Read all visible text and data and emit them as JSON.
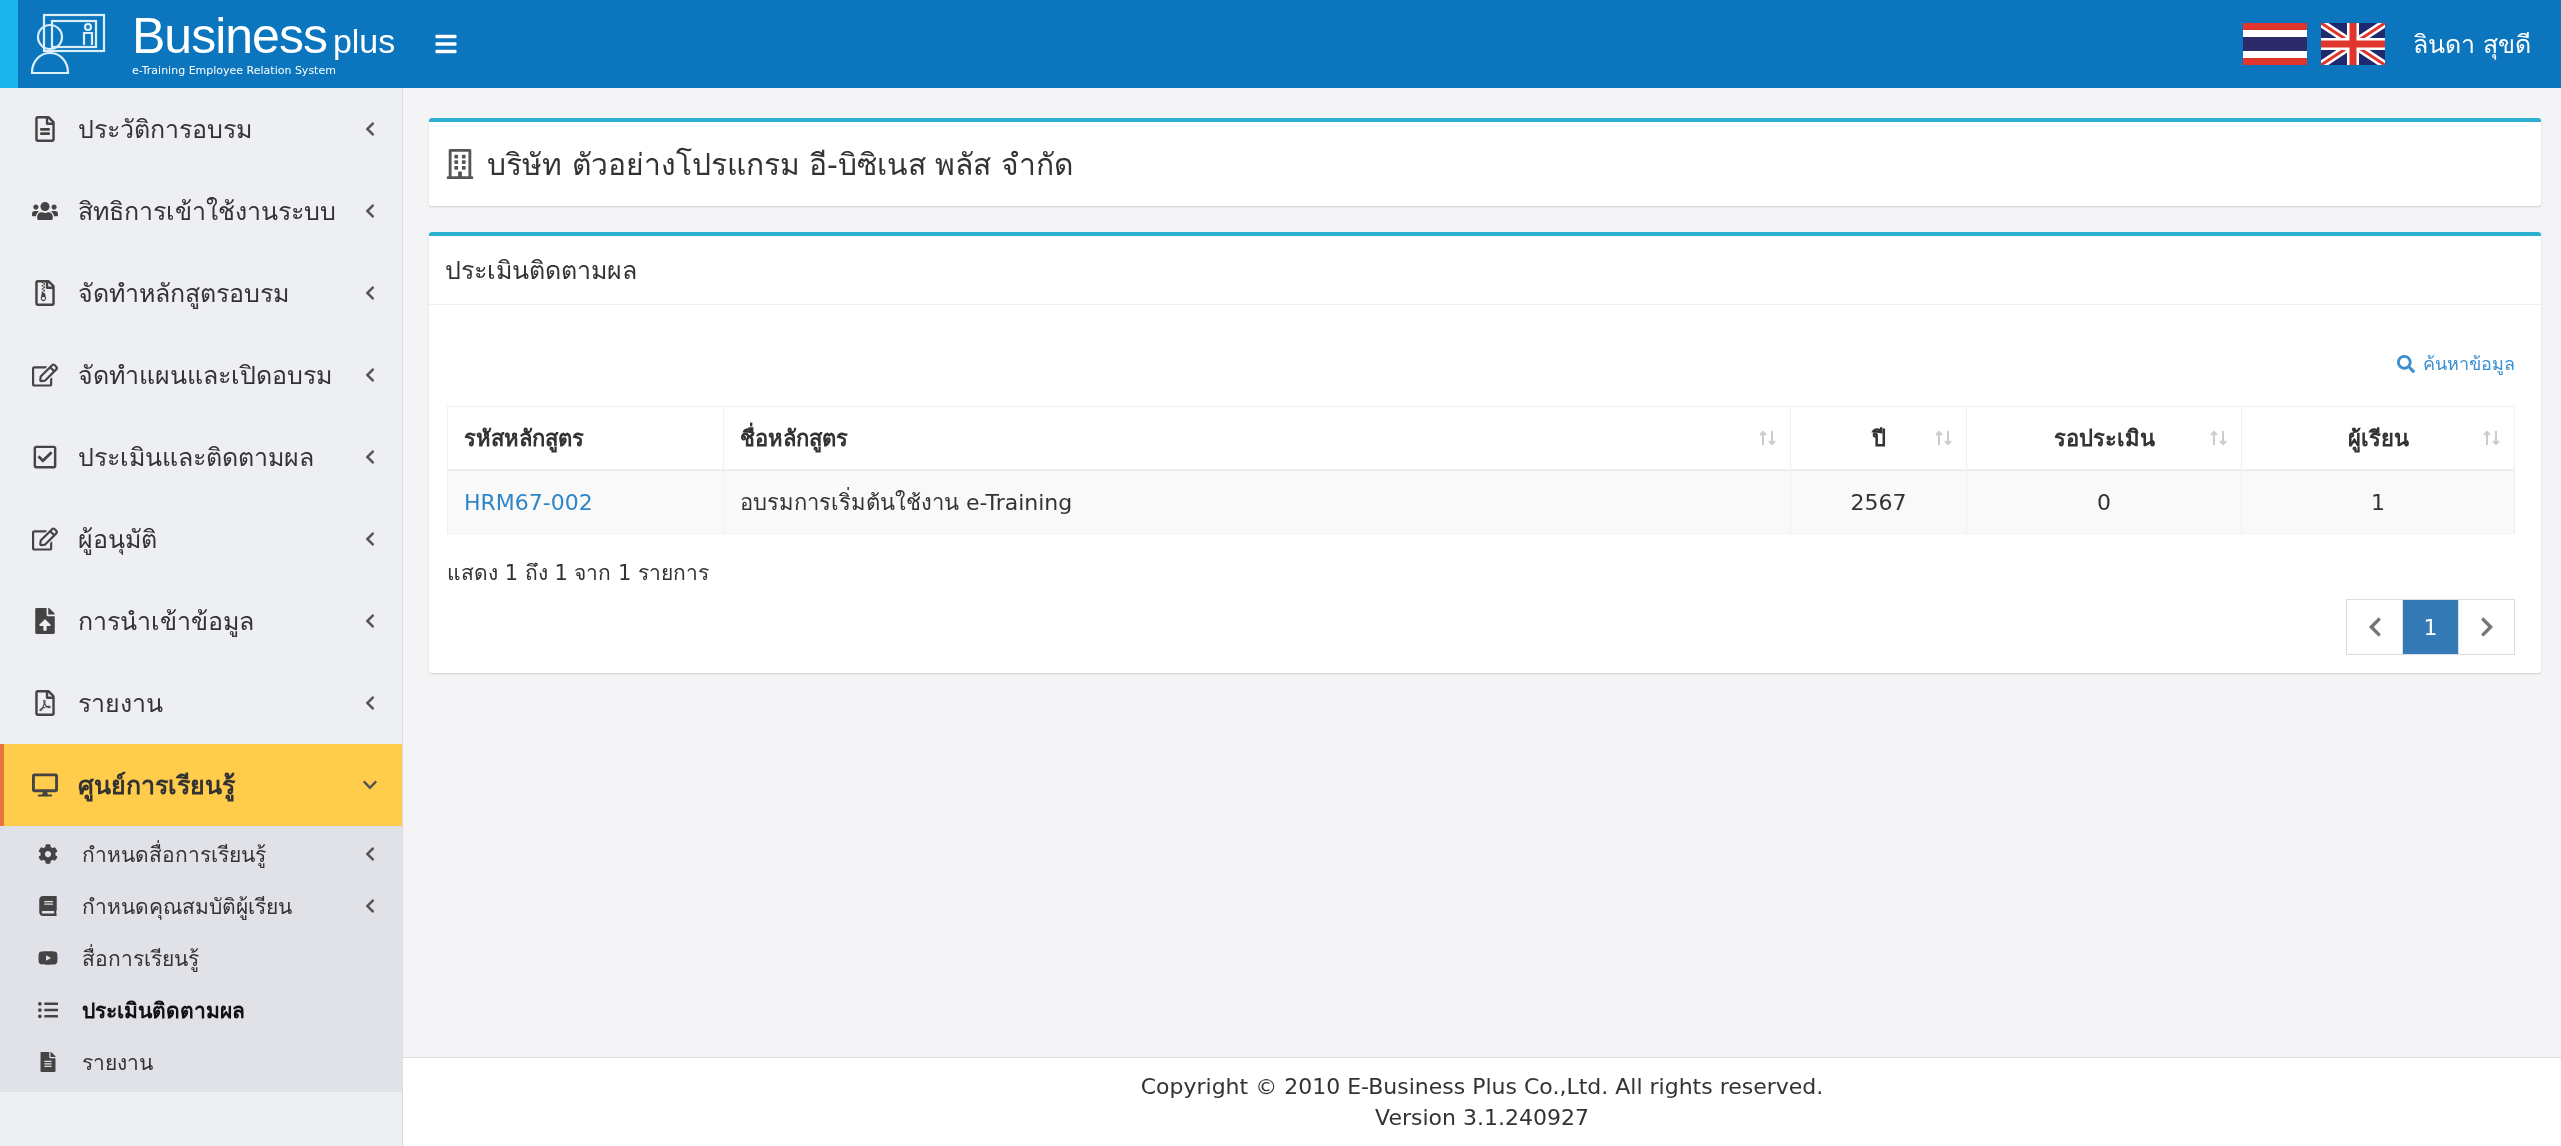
{
  "header": {
    "logo": {
      "brand": "Business",
      "brand_suffix": "plus",
      "tagline": "e-Training Employee Relation System"
    },
    "user_name": "ลินดา สุขดี"
  },
  "sidebar": {
    "items": [
      {
        "label": "ประวัติการอบรม",
        "selected": false,
        "expanded": false
      },
      {
        "label": "สิทธิการเข้าใช้งานระบบ",
        "selected": false,
        "expanded": false
      },
      {
        "label": "จัดทำหลักสูตรอบรม",
        "selected": false,
        "expanded": false
      },
      {
        "label": "จัดทำแผนและเปิดอบรม",
        "selected": false,
        "expanded": false
      },
      {
        "label": "ประเมินและติดตามผล",
        "selected": false,
        "expanded": false
      },
      {
        "label": "ผู้อนุมัติ",
        "selected": false,
        "expanded": false
      },
      {
        "label": "การนำเข้าข้อมูล",
        "selected": false,
        "expanded": false
      },
      {
        "label": "รายงาน",
        "selected": false,
        "expanded": false
      },
      {
        "label": "ศูนย์การเรียนรู้",
        "selected": true,
        "expanded": true,
        "children": [
          {
            "label": "กำหนดสื่อการเรียนรู้",
            "selected": false,
            "has_submenu": true
          },
          {
            "label": "กำหนดคุณสมบัติผู้เรียน",
            "selected": false,
            "has_submenu": true
          },
          {
            "label": "สื่อการเรียนรู้",
            "selected": false,
            "has_submenu": false
          },
          {
            "label": "ประเมินติดตามผล",
            "selected": true,
            "has_submenu": false
          },
          {
            "label": "รายงาน",
            "selected": false,
            "has_submenu": false
          }
        ]
      }
    ]
  },
  "company_card": {
    "title": "บริษัท ตัวอย่างโปรแกรม อี-บิซิเนส พลัส จำกัด"
  },
  "panel": {
    "title": "ประเมินติดตามผล",
    "search_link": "ค้นหาข้อมูล",
    "table": {
      "columns": [
        {
          "label": "รหัสหลักสูตร",
          "sortable": false
        },
        {
          "label": "ชื่อหลักสูตร",
          "sortable": true
        },
        {
          "label": "ปี",
          "sortable": true
        },
        {
          "label": "รอประเมิน",
          "sortable": true
        },
        {
          "label": "ผู้เรียน",
          "sortable": true
        }
      ],
      "rows": [
        [
          "HRM67-002",
          "อบรมการเริ่มต้นใช้งาน e-Training",
          "2567",
          "0",
          "1"
        ]
      ]
    },
    "info": "แสดง 1 ถึง 1 จาก 1 รายการ",
    "pagination": {
      "pages": [
        {
          "label": "1",
          "selected": true
        }
      ]
    }
  },
  "footer": {
    "copyright": "Copyright © 2010 E-Business Plus Co.,Ltd. All rights reserved.",
    "version": "Version 3.1.240927"
  }
}
